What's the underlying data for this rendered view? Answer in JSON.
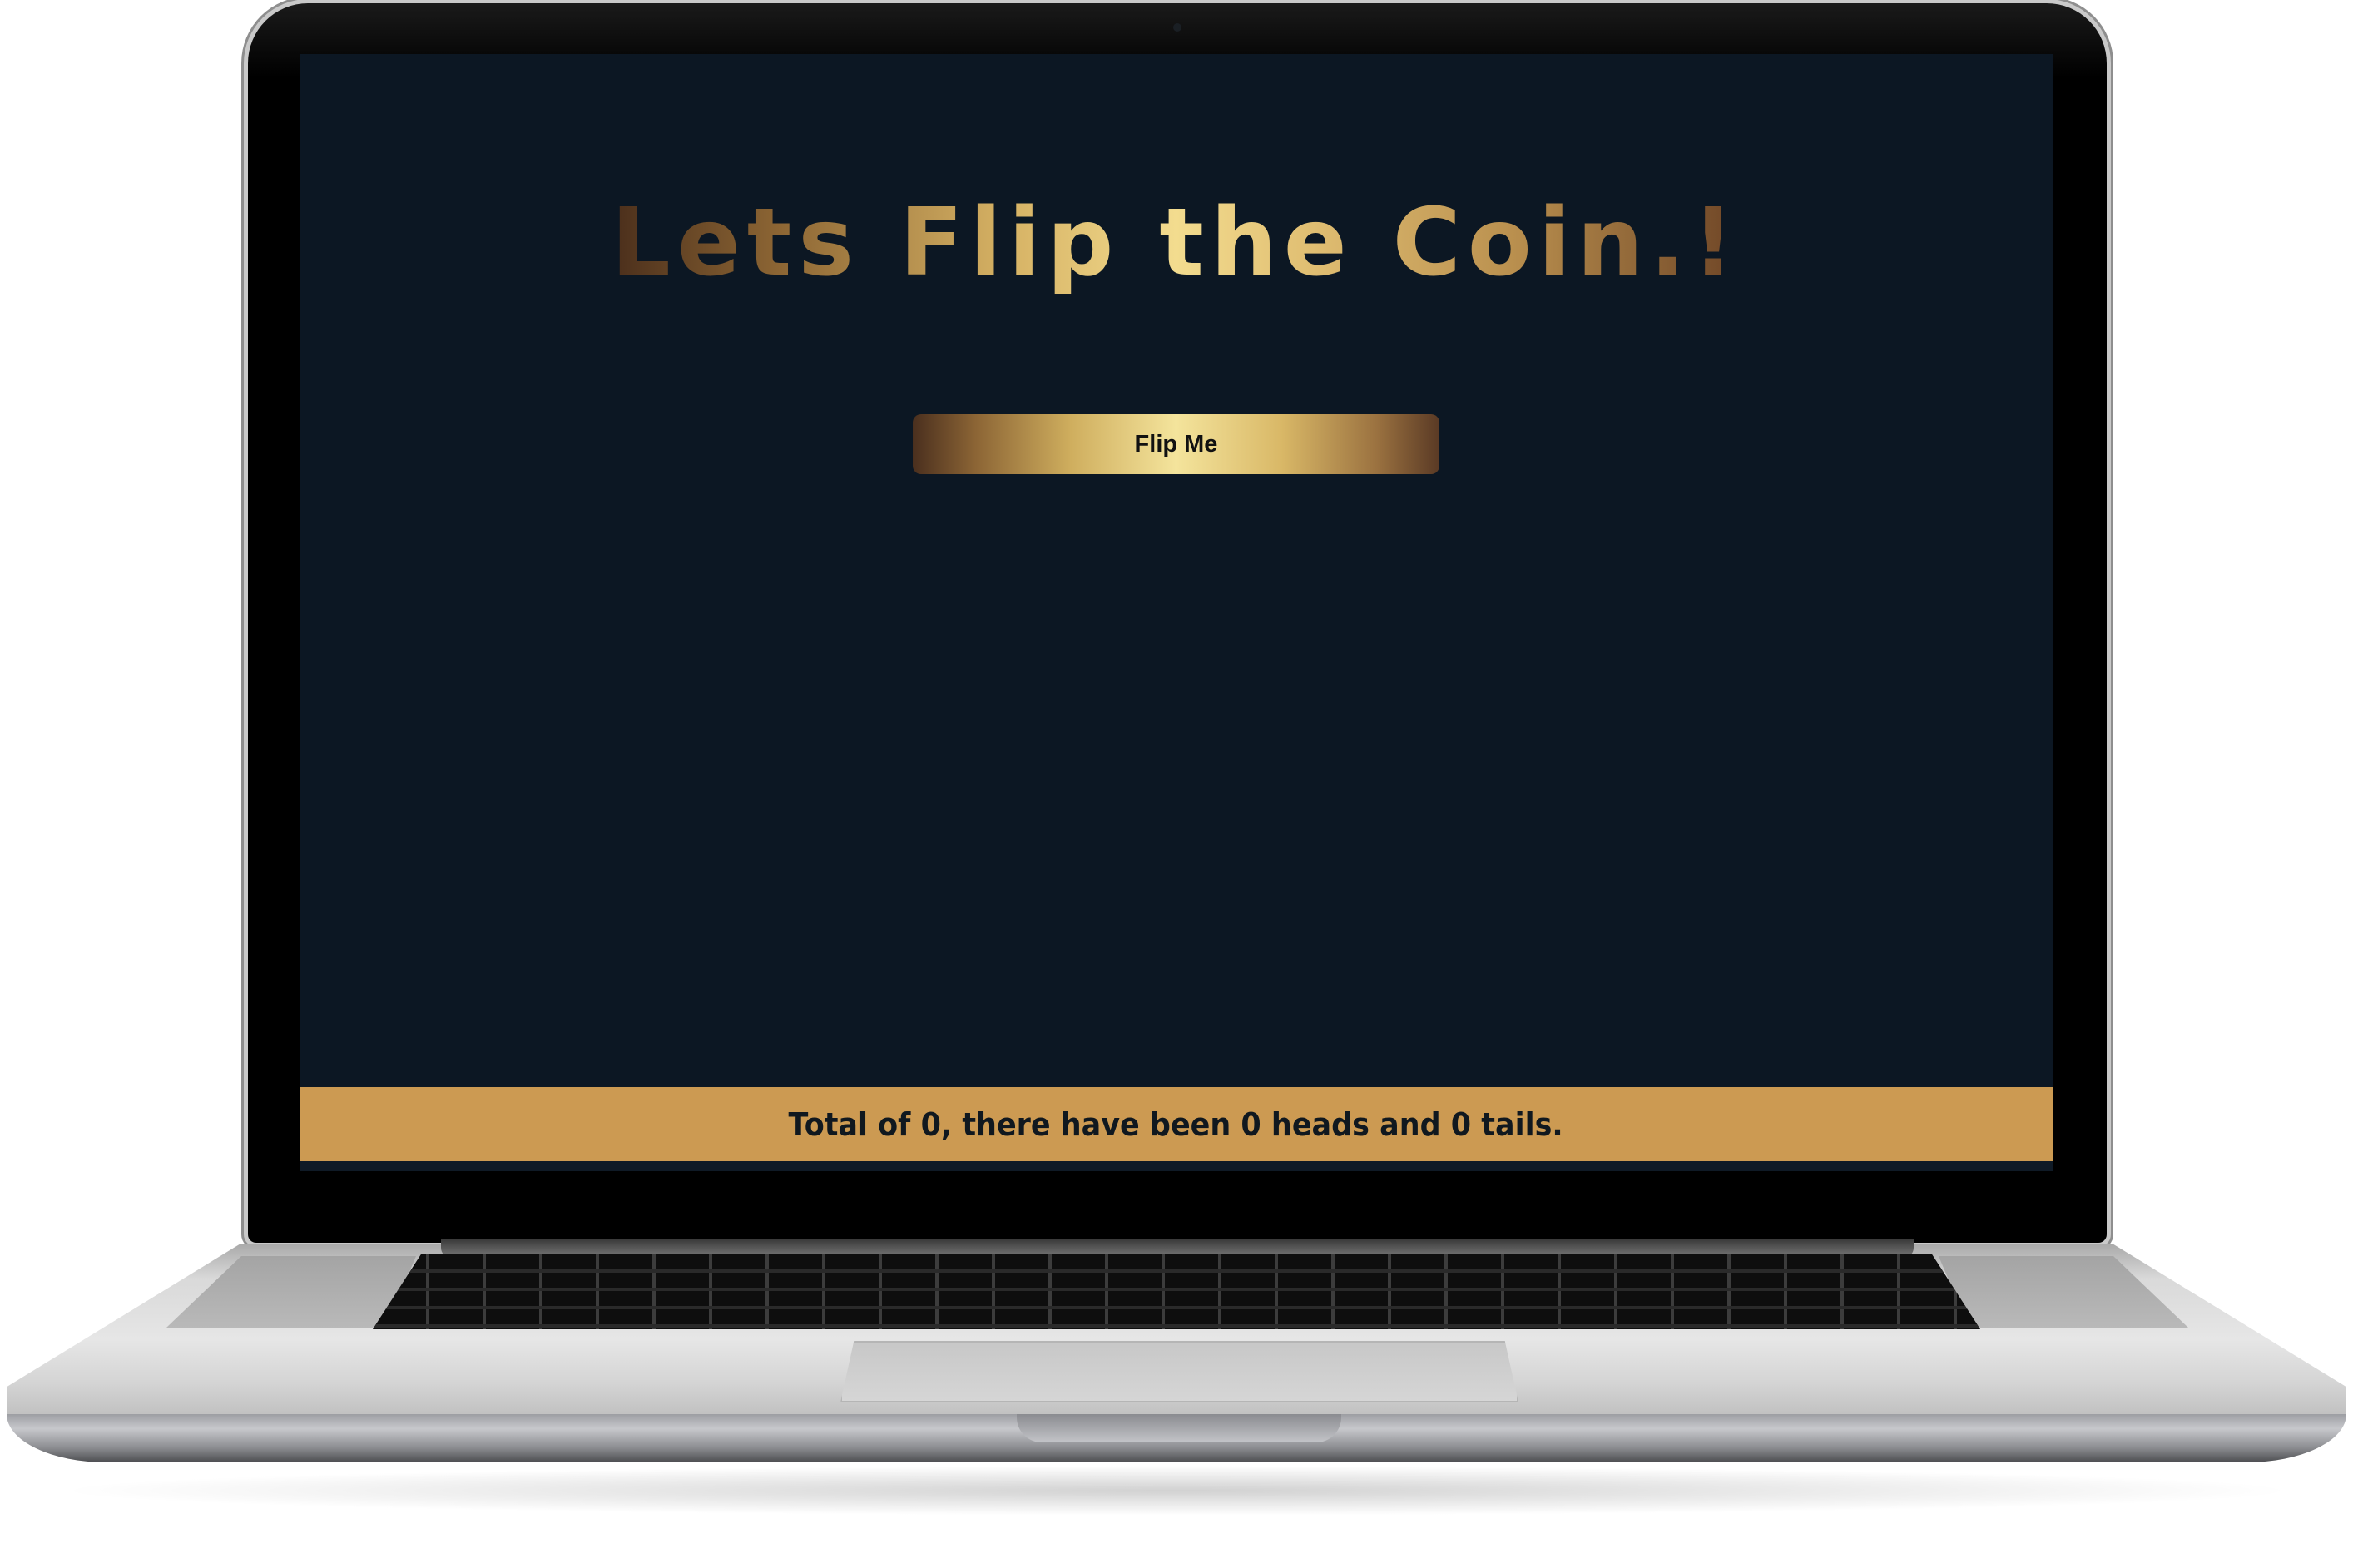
{
  "page": {
    "title": "Lets Flip the Coin.!",
    "flip_button_label": "Flip Me",
    "status_text": "Total of 0, there have been 0 heads and 0 tails."
  },
  "stats": {
    "total": 0,
    "heads": 0,
    "tails": 0
  },
  "colors": {
    "screen_background": "#0c1723",
    "footer_background": "#cc9a52",
    "gold_light": "#f4e49c",
    "gold_dark": "#4a2f1e"
  }
}
